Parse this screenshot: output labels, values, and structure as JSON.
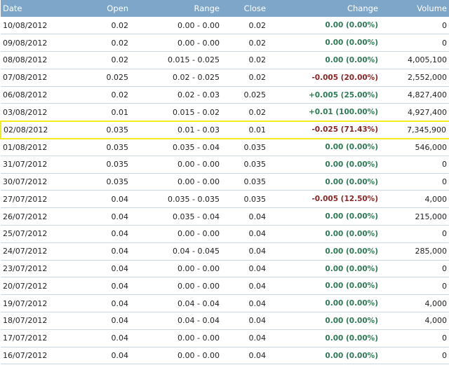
{
  "columns": {
    "date": "Date",
    "open": "Open",
    "range": "Range",
    "close": "Close",
    "change": "Change",
    "volume": "Volume"
  },
  "colors": {
    "header_bg": "#7ea6c8",
    "positive": "#2f7a55",
    "negative": "#8a2525",
    "highlight_border": "#f2ea1a"
  },
  "highlighted_row_index": 6,
  "rows": [
    {
      "date": "10/08/2012",
      "open": "0.02",
      "range": "0.00 - 0.00",
      "close": "0.02",
      "change": "0.00 (0.00%)",
      "direction": "flat",
      "volume": "0"
    },
    {
      "date": "09/08/2012",
      "open": "0.02",
      "range": "0.00 - 0.00",
      "close": "0.02",
      "change": "0.00 (0.00%)",
      "direction": "flat",
      "volume": "0"
    },
    {
      "date": "08/08/2012",
      "open": "0.02",
      "range": "0.015 - 0.025",
      "close": "0.02",
      "change": "0.00 (0.00%)",
      "direction": "flat",
      "volume": "4,005,100"
    },
    {
      "date": "07/08/2012",
      "open": "0.025",
      "range": "0.02 - 0.025",
      "close": "0.02",
      "change": "-0.005 (20.00%)",
      "direction": "neg",
      "volume": "2,552,000"
    },
    {
      "date": "06/08/2012",
      "open": "0.02",
      "range": "0.02 - 0.03",
      "close": "0.025",
      "change": "+0.005 (25.00%)",
      "direction": "pos",
      "volume": "4,827,400"
    },
    {
      "date": "03/08/2012",
      "open": "0.01",
      "range": "0.015 - 0.02",
      "close": "0.02",
      "change": "+0.01 (100.00%)",
      "direction": "pos",
      "volume": "4,927,400"
    },
    {
      "date": "02/08/2012",
      "open": "0.035",
      "range": "0.01 - 0.03",
      "close": "0.01",
      "change": "-0.025 (71.43%)",
      "direction": "neg",
      "volume": "7,345,900"
    },
    {
      "date": "01/08/2012",
      "open": "0.035",
      "range": "0.035 - 0.04",
      "close": "0.035",
      "change": "0.00 (0.00%)",
      "direction": "flat",
      "volume": "546,000"
    },
    {
      "date": "31/07/2012",
      "open": "0.035",
      "range": "0.00 - 0.00",
      "close": "0.035",
      "change": "0.00 (0.00%)",
      "direction": "flat",
      "volume": "0"
    },
    {
      "date": "30/07/2012",
      "open": "0.035",
      "range": "0.00 - 0.00",
      "close": "0.035",
      "change": "0.00 (0.00%)",
      "direction": "flat",
      "volume": "0"
    },
    {
      "date": "27/07/2012",
      "open": "0.04",
      "range": "0.035 - 0.035",
      "close": "0.035",
      "change": "-0.005 (12.50%)",
      "direction": "neg",
      "volume": "4,000"
    },
    {
      "date": "26/07/2012",
      "open": "0.04",
      "range": "0.035 - 0.04",
      "close": "0.04",
      "change": "0.00 (0.00%)",
      "direction": "flat",
      "volume": "215,000"
    },
    {
      "date": "25/07/2012",
      "open": "0.04",
      "range": "0.00 - 0.00",
      "close": "0.04",
      "change": "0.00 (0.00%)",
      "direction": "flat",
      "volume": "0"
    },
    {
      "date": "24/07/2012",
      "open": "0.04",
      "range": "0.04 - 0.045",
      "close": "0.04",
      "change": "0.00 (0.00%)",
      "direction": "flat",
      "volume": "285,000"
    },
    {
      "date": "23/07/2012",
      "open": "0.04",
      "range": "0.00 - 0.00",
      "close": "0.04",
      "change": "0.00 (0.00%)",
      "direction": "flat",
      "volume": "0"
    },
    {
      "date": "20/07/2012",
      "open": "0.04",
      "range": "0.00 - 0.00",
      "close": "0.04",
      "change": "0.00 (0.00%)",
      "direction": "flat",
      "volume": "0"
    },
    {
      "date": "19/07/2012",
      "open": "0.04",
      "range": "0.04 - 0.04",
      "close": "0.04",
      "change": "0.00 (0.00%)",
      "direction": "flat",
      "volume": "4,000"
    },
    {
      "date": "18/07/2012",
      "open": "0.04",
      "range": "0.04 - 0.04",
      "close": "0.04",
      "change": "0.00 (0.00%)",
      "direction": "flat",
      "volume": "4,000"
    },
    {
      "date": "17/07/2012",
      "open": "0.04",
      "range": "0.00 - 0.00",
      "close": "0.04",
      "change": "0.00 (0.00%)",
      "direction": "flat",
      "volume": "0"
    },
    {
      "date": "16/07/2012",
      "open": "0.04",
      "range": "0.00 - 0.00",
      "close": "0.04",
      "change": "0.00 (0.00%)",
      "direction": "flat",
      "volume": "0"
    }
  ]
}
